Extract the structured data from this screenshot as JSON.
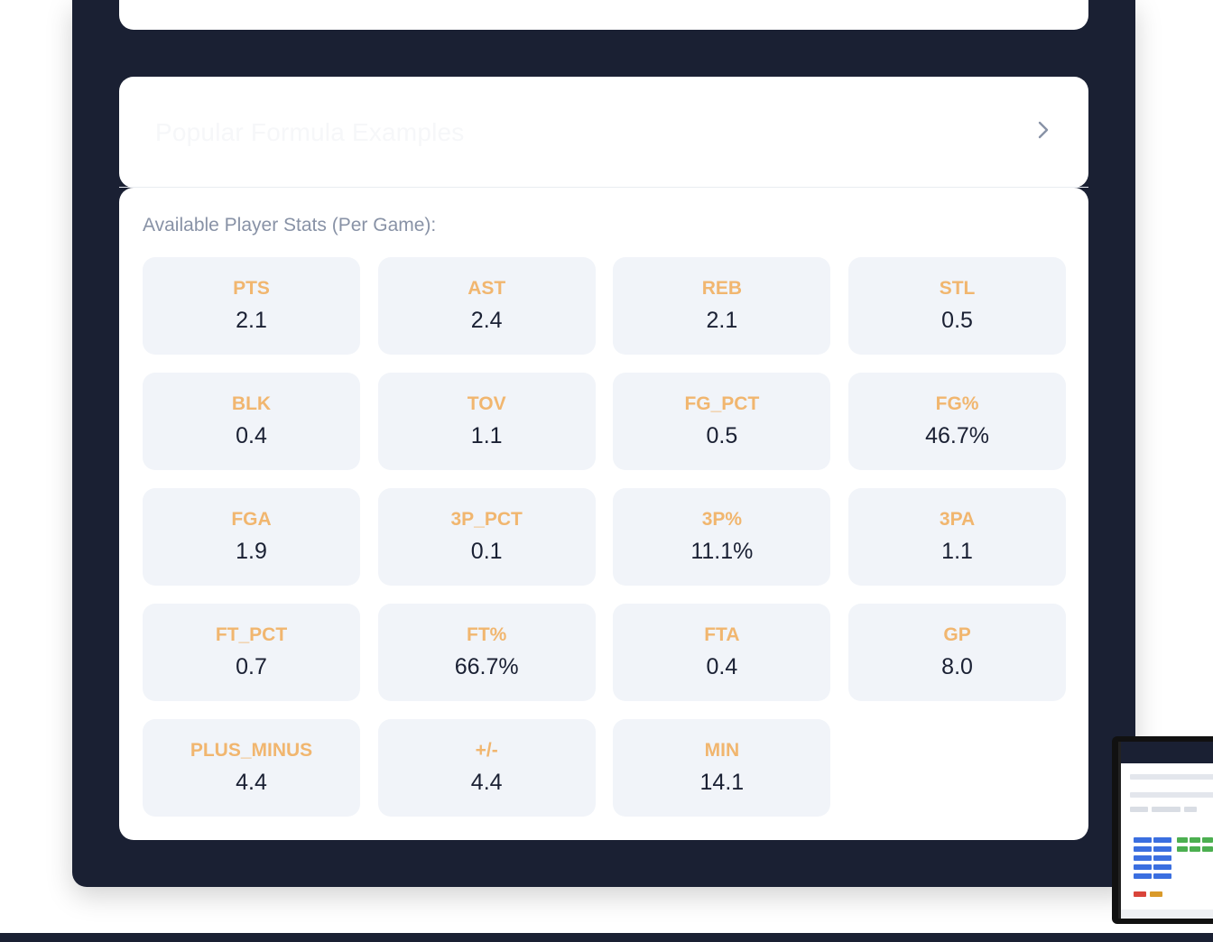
{
  "accordion": {
    "title": "Popular Formula Examples",
    "chevron_icon": "chevron-right-icon"
  },
  "stats": {
    "heading": "Available Player Stats (Per Game):",
    "items": [
      {
        "name": "PTS",
        "value": "2.1"
      },
      {
        "name": "AST",
        "value": "2.4"
      },
      {
        "name": "REB",
        "value": "2.1"
      },
      {
        "name": "STL",
        "value": "0.5"
      },
      {
        "name": "BLK",
        "value": "0.4"
      },
      {
        "name": "TOV",
        "value": "1.1"
      },
      {
        "name": "FG_PCT",
        "value": "0.5"
      },
      {
        "name": "FG%",
        "value": "46.7%"
      },
      {
        "name": "FGA",
        "value": "1.9"
      },
      {
        "name": "3P_PCT",
        "value": "0.1"
      },
      {
        "name": "3P%",
        "value": "11.1%"
      },
      {
        "name": "3PA",
        "value": "1.1"
      },
      {
        "name": "FT_PCT",
        "value": "0.7"
      },
      {
        "name": "FT%",
        "value": "66.7%"
      },
      {
        "name": "FTA",
        "value": "0.4"
      },
      {
        "name": "GP",
        "value": "8.0"
      },
      {
        "name": "PLUS_MINUS",
        "value": "4.4"
      },
      {
        "name": "+/-",
        "value": "4.4"
      },
      {
        "name": "MIN",
        "value": "14.1"
      }
    ]
  },
  "colors": {
    "panel_bg": "#1a2033",
    "tile_bg": "#f1f4f9",
    "stat_label": "#f1b66f",
    "heading_text": "#8892a6",
    "value_text": "#1a2033"
  }
}
